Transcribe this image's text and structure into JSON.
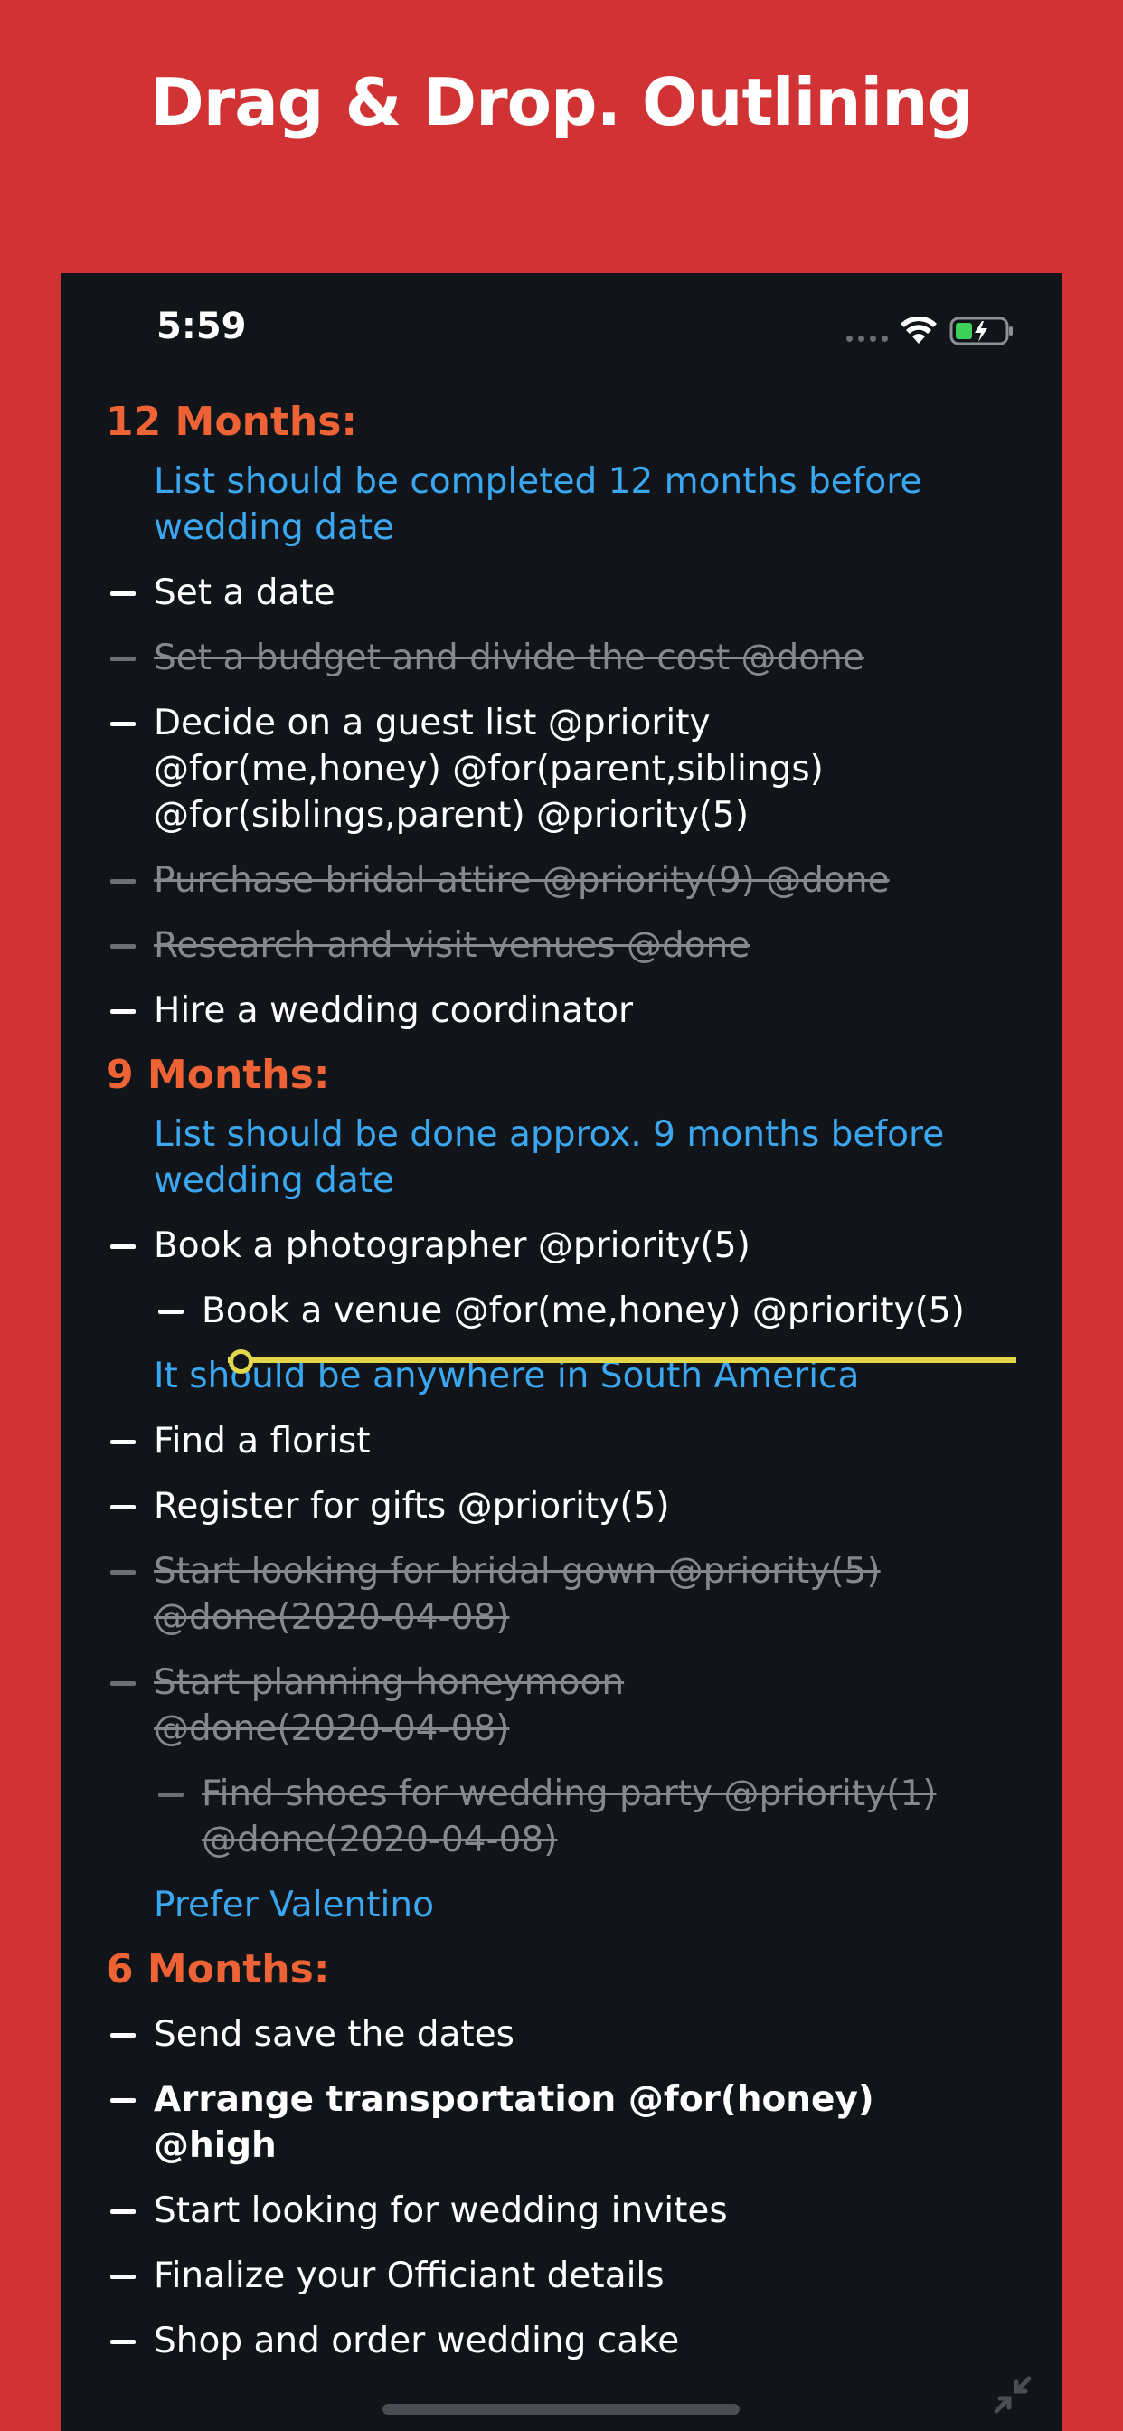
{
  "headline": "Drag & Drop. Outlining",
  "status": {
    "time": "5:59",
    "icons": [
      "signal-dots-icon",
      "wifi-icon",
      "battery-charging-icon"
    ]
  },
  "colors": {
    "background": "#d13334",
    "screen": "#111419",
    "heading": "#ee6335",
    "note": "#3ba7f0",
    "drop_indicator": "#e2d64a",
    "done": "#85888d"
  },
  "outline": {
    "h12": "12 Months:",
    "n12": "List should be completed 12 months before wedding date",
    "i1": "Set a date",
    "i2": "Set a budget and divide the cost @done",
    "i3": "Decide on a guest list @priority @for(me,honey) @for(parent,siblings) @for(siblings,parent) @priority(5)",
    "i4": "Purchase bridal attire @priority(9) @done",
    "i5": "Research and visit venues @done",
    "i6": "Hire a wedding coordinator",
    "h9": "9 Months:",
    "n9": "List should be done approx. 9 months before wedding date",
    "i7": "Book a photographer @priority(5)",
    "i8": "Book a venue @for(me,honey) @priority(5)",
    "n9b": "It should be anywhere in South America",
    "i9": "Find a florist",
    "i10": "Register for gifts @priority(5)",
    "i11": "Start looking for bridal gown @priority(5) @done(2020-04-08)",
    "i12": "Start planning honeymoon @done(2020-04-08)",
    "i13": "Find shoes for wedding party @priority(1) @done(2020-04-08)",
    "n9c": "Prefer Valentino",
    "h6": "6 Months:",
    "i14": "Send save the dates",
    "i15": "Arrange transportation @for(honey) @high",
    "i16": "Start looking for wedding invites",
    "i17": "Finalize your Officiant details",
    "i18": "Shop and order wedding cake"
  }
}
